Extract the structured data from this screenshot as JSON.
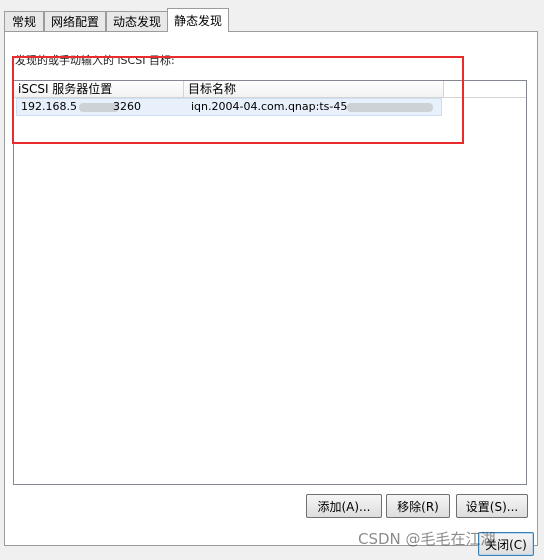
{
  "tabs": [
    {
      "label": "常规"
    },
    {
      "label": "网络配置"
    },
    {
      "label": "动态发现"
    },
    {
      "label": "静态发现"
    }
  ],
  "section_label": "发现的或手动输入的 iSCSI 目标:",
  "list": {
    "columns": [
      "iSCSI 服务器位置",
      "目标名称"
    ],
    "rows": [
      {
        "server_prefix": "192.168.5",
        "server_suffix": "3260",
        "target_prefix": "iqn.2004-04.com.qnap:ts-45"
      }
    ]
  },
  "buttons": {
    "add": "添加(A)...",
    "remove": "移除(R)",
    "settings": "设置(S)...",
    "close": "关闭(C)"
  },
  "watermark": "CSDN @毛毛在江湖",
  "colors": {
    "annotation": "#ea2b2b",
    "selection": "#e8f1fb"
  }
}
